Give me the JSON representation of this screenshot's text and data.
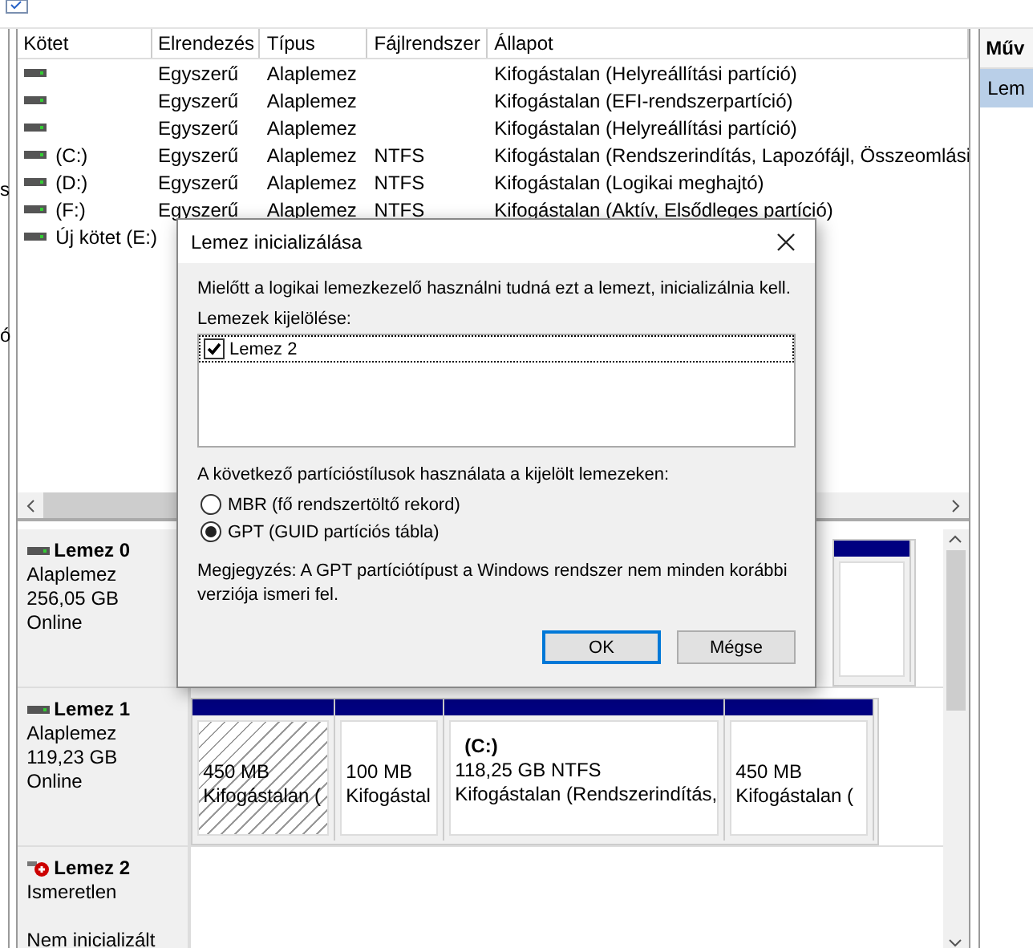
{
  "left_edge": {
    "texts": [
      "s",
      "ó"
    ]
  },
  "volumes": {
    "columns": [
      "Kötet",
      "Elrendezés",
      "Típus",
      "Fájlrendszer",
      "Állapot"
    ],
    "rows": [
      {
        "cells": [
          null,
          "Egyszerű",
          "Alaplemez",
          null,
          "Kifogástalan (Helyreállítási partíció)"
        ]
      },
      {
        "cells": [
          null,
          "Egyszerű",
          "Alaplemez",
          null,
          "Kifogástalan (EFI-rendszerpartíció)"
        ]
      },
      {
        "cells": [
          null,
          "Egyszerű",
          "Alaplemez",
          null,
          "Kifogástalan (Helyreállítási partíció)"
        ]
      },
      {
        "cells": [
          "(C:)",
          "Egyszerű",
          "Alaplemez",
          "NTFS",
          "Kifogástalan (Rendszerindítás, Lapozófájl, Összeomlási"
        ]
      },
      {
        "cells": [
          "(D:)",
          "Egyszerű",
          "Alaplemez",
          "NTFS",
          "Kifogástalan (Logikai meghajtó)"
        ]
      },
      {
        "cells": [
          "(F:)",
          "Egyszerű",
          "Alaplemez",
          "NTFS",
          "Kifogástalan (Aktív, Elsődleges partíció)"
        ]
      },
      {
        "cells": [
          "Új kötet (E:)",
          null,
          null,
          null,
          null
        ]
      }
    ]
  },
  "disks": [
    {
      "name": "Lemez 0",
      "kind": "basic",
      "type": "Alaplemez",
      "size": "256,05 GB",
      "status": "Online",
      "partitions": [
        {
          "kind": "plain"
        }
      ]
    },
    {
      "name": "Lemez 1",
      "kind": "basic",
      "type": "Alaplemez",
      "size": "119,23 GB",
      "status": "Online",
      "partitions": [
        {
          "kind": "hatched",
          "lines": [
            "450 MB",
            "Kifogástalan ("
          ]
        },
        {
          "kind": "plain",
          "lines": [
            "100 MB",
            "Kifogástal"
          ]
        },
        {
          "kind": "plain",
          "label": "(C:)",
          "lines": [
            "118,25 GB NTFS",
            "Kifogástalan (Rendszerindítás,"
          ]
        },
        {
          "kind": "plain",
          "lines": [
            "450 MB",
            "Kifogástalan ("
          ]
        }
      ]
    },
    {
      "name": "Lemez 2",
      "kind": "unknown",
      "type": "Ismeretlen",
      "status": "Nem inicializált"
    }
  ],
  "actions_panel": {
    "title": "Műv",
    "items": [
      {
        "label": "Lem",
        "selected": true
      }
    ]
  },
  "dialog": {
    "title": "Lemez inicializálása",
    "intro": "Mielőtt a logikai lemezkezelő használni tudná ezt a lemezt, inicializálnia kell.",
    "list_label": "Lemezek kijelölése:",
    "disks": [
      {
        "label": "Lemez 2",
        "checked": true,
        "selected": true
      }
    ],
    "style_label": "A következő partícióstílusok használata a kijelölt lemezeken:",
    "styles": [
      {
        "label": "MBR (fő rendszertöltő rekord)",
        "selected": false
      },
      {
        "label": "GPT (GUID partíciós tábla)",
        "selected": true
      }
    ],
    "note": "Megjegyzés: A GPT partíciótípust a Windows rendszer nem minden korábbi verziója ismeri fel.",
    "buttons": [
      {
        "label": "OK",
        "default": true
      },
      {
        "label": "Mégse",
        "default": false
      }
    ]
  }
}
